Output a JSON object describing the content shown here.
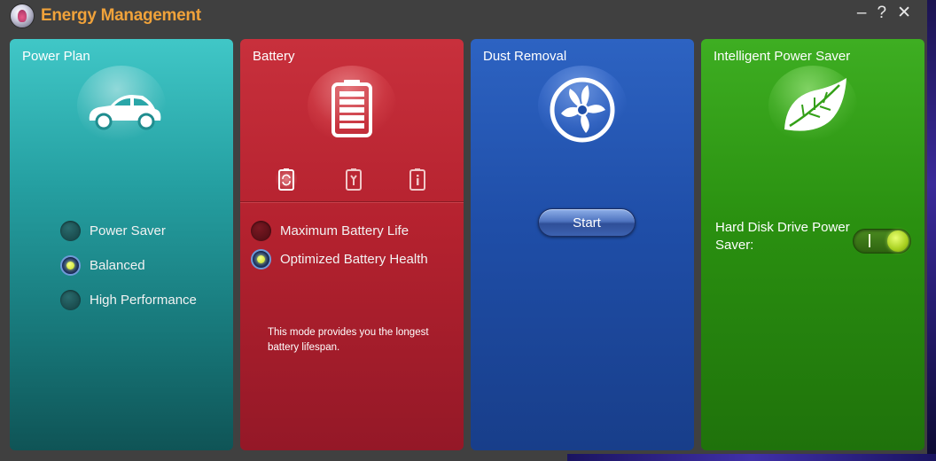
{
  "window": {
    "title": "Energy Management",
    "controls": {
      "minimize": "–",
      "help": "?",
      "close": "✕"
    },
    "logo_icon": "energy-gauge-icon"
  },
  "panels": {
    "power_plan": {
      "title": "Power Plan",
      "icon": "car-icon",
      "color": "#25a0a2",
      "options": [
        {
          "label": "Power Saver",
          "selected": false
        },
        {
          "label": "Balanced",
          "selected": true
        },
        {
          "label": "High Performance",
          "selected": false
        }
      ]
    },
    "battery": {
      "title": "Battery",
      "icon": "battery-icon",
      "color": "#b5222f",
      "tabs": [
        {
          "icon": "battery-refresh-icon",
          "active": true
        },
        {
          "icon": "battery-wrench-icon",
          "active": false
        },
        {
          "icon": "battery-info-icon",
          "active": false
        }
      ],
      "options": [
        {
          "label": "Maximum Battery Life",
          "selected": false
        },
        {
          "label": "Optimized Battery Health",
          "selected": true
        }
      ],
      "description": "This mode provides you the longest battery lifespan."
    },
    "dust_removal": {
      "title": "Dust Removal",
      "icon": "fan-icon",
      "color": "#1f4ea8",
      "start_label": "Start"
    },
    "intelligent_power_saver": {
      "title": "Intelligent Power Saver",
      "icon": "leaf-icon",
      "color": "#2a9010",
      "hdd_label": "Hard Disk Drive Power Saver:",
      "hdd_toggle_on": true,
      "toggle_on_glyph": "I"
    }
  }
}
